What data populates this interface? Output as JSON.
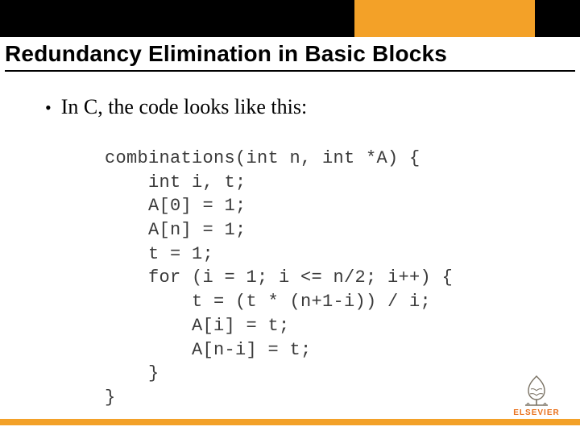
{
  "title": "Redundancy Elimination in Basic Blocks",
  "bullet": "In C, the code looks like this:",
  "code_lines": [
    "combinations(int n, int *A) {",
    "    int i, t;",
    "    A[0] = 1;",
    "    A[n] = 1;",
    "    t = 1;",
    "    for (i = 1; i <= n/2; i++) {",
    "        t = (t * (n+1-i)) / i;",
    "        A[i] = t;",
    "        A[n-i] = t;",
    "    }",
    "}"
  ],
  "logo": {
    "label": "ELSEVIER"
  },
  "colors": {
    "accent": "#f3a128",
    "logo": "#e9711c"
  }
}
